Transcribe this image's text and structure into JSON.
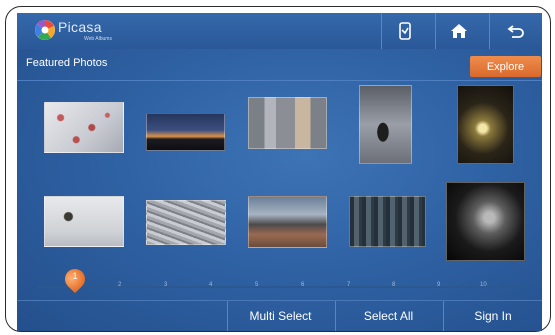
{
  "app": {
    "brand_name": "Picasa",
    "brand_sub": "Web Albums",
    "colors": {
      "background": "#2f62a4",
      "accent": "#e57a36",
      "text": "#ffffff"
    }
  },
  "topbar": {
    "buttons": [
      {
        "icon": "phone-sync-icon"
      },
      {
        "icon": "home-icon"
      },
      {
        "icon": "back-icon"
      }
    ]
  },
  "header": {
    "title": "Featured Photos",
    "explore_label": "Explore"
  },
  "gallery": {
    "photos": [
      {
        "subject": "red berries with frost"
      },
      {
        "subject": "city skyline at sunset"
      },
      {
        "subject": "busy street"
      },
      {
        "subject": "penguin"
      },
      {
        "subject": "lamp in the dark"
      },
      {
        "subject": "small bird on snow"
      },
      {
        "subject": "flock of birds"
      },
      {
        "subject": "rocky shore"
      },
      {
        "subject": "forest"
      },
      {
        "subject": "cat portrait"
      }
    ]
  },
  "pagination": {
    "current": "1",
    "pages": [
      "2",
      "3",
      "4",
      "5",
      "6",
      "7",
      "8",
      "9",
      "10"
    ]
  },
  "bottombar": {
    "multi_select": "Multi Select",
    "select_all": "Select All",
    "sign_in": "Sign In"
  }
}
